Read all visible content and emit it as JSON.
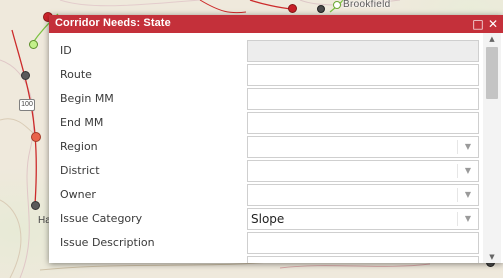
{
  "map": {
    "town_label": "Brookfield",
    "route_shield": "100",
    "partial_label": "Ha",
    "colors": {
      "route_red": "#cc2b2b",
      "route_green": "#7cc242",
      "route_grey": "#777777"
    }
  },
  "dialog": {
    "title": "Corridor Needs: State",
    "maximize_icon": "maximize-icon",
    "close_icon": "close-icon",
    "titlebar_color": "#c4303a",
    "fields": [
      {
        "label": "ID",
        "value": "",
        "type": "readonly"
      },
      {
        "label": "Route",
        "value": "",
        "type": "text"
      },
      {
        "label": "Begin MM",
        "value": "",
        "type": "text"
      },
      {
        "label": "End MM",
        "value": "",
        "type": "text"
      },
      {
        "label": "Region",
        "value": "",
        "type": "select"
      },
      {
        "label": "District",
        "value": "",
        "type": "select"
      },
      {
        "label": "Owner",
        "value": "",
        "type": "select"
      },
      {
        "label": "Issue Category",
        "value": "Slope",
        "type": "select"
      },
      {
        "label": "Issue Description",
        "value": "",
        "type": "text"
      }
    ]
  }
}
